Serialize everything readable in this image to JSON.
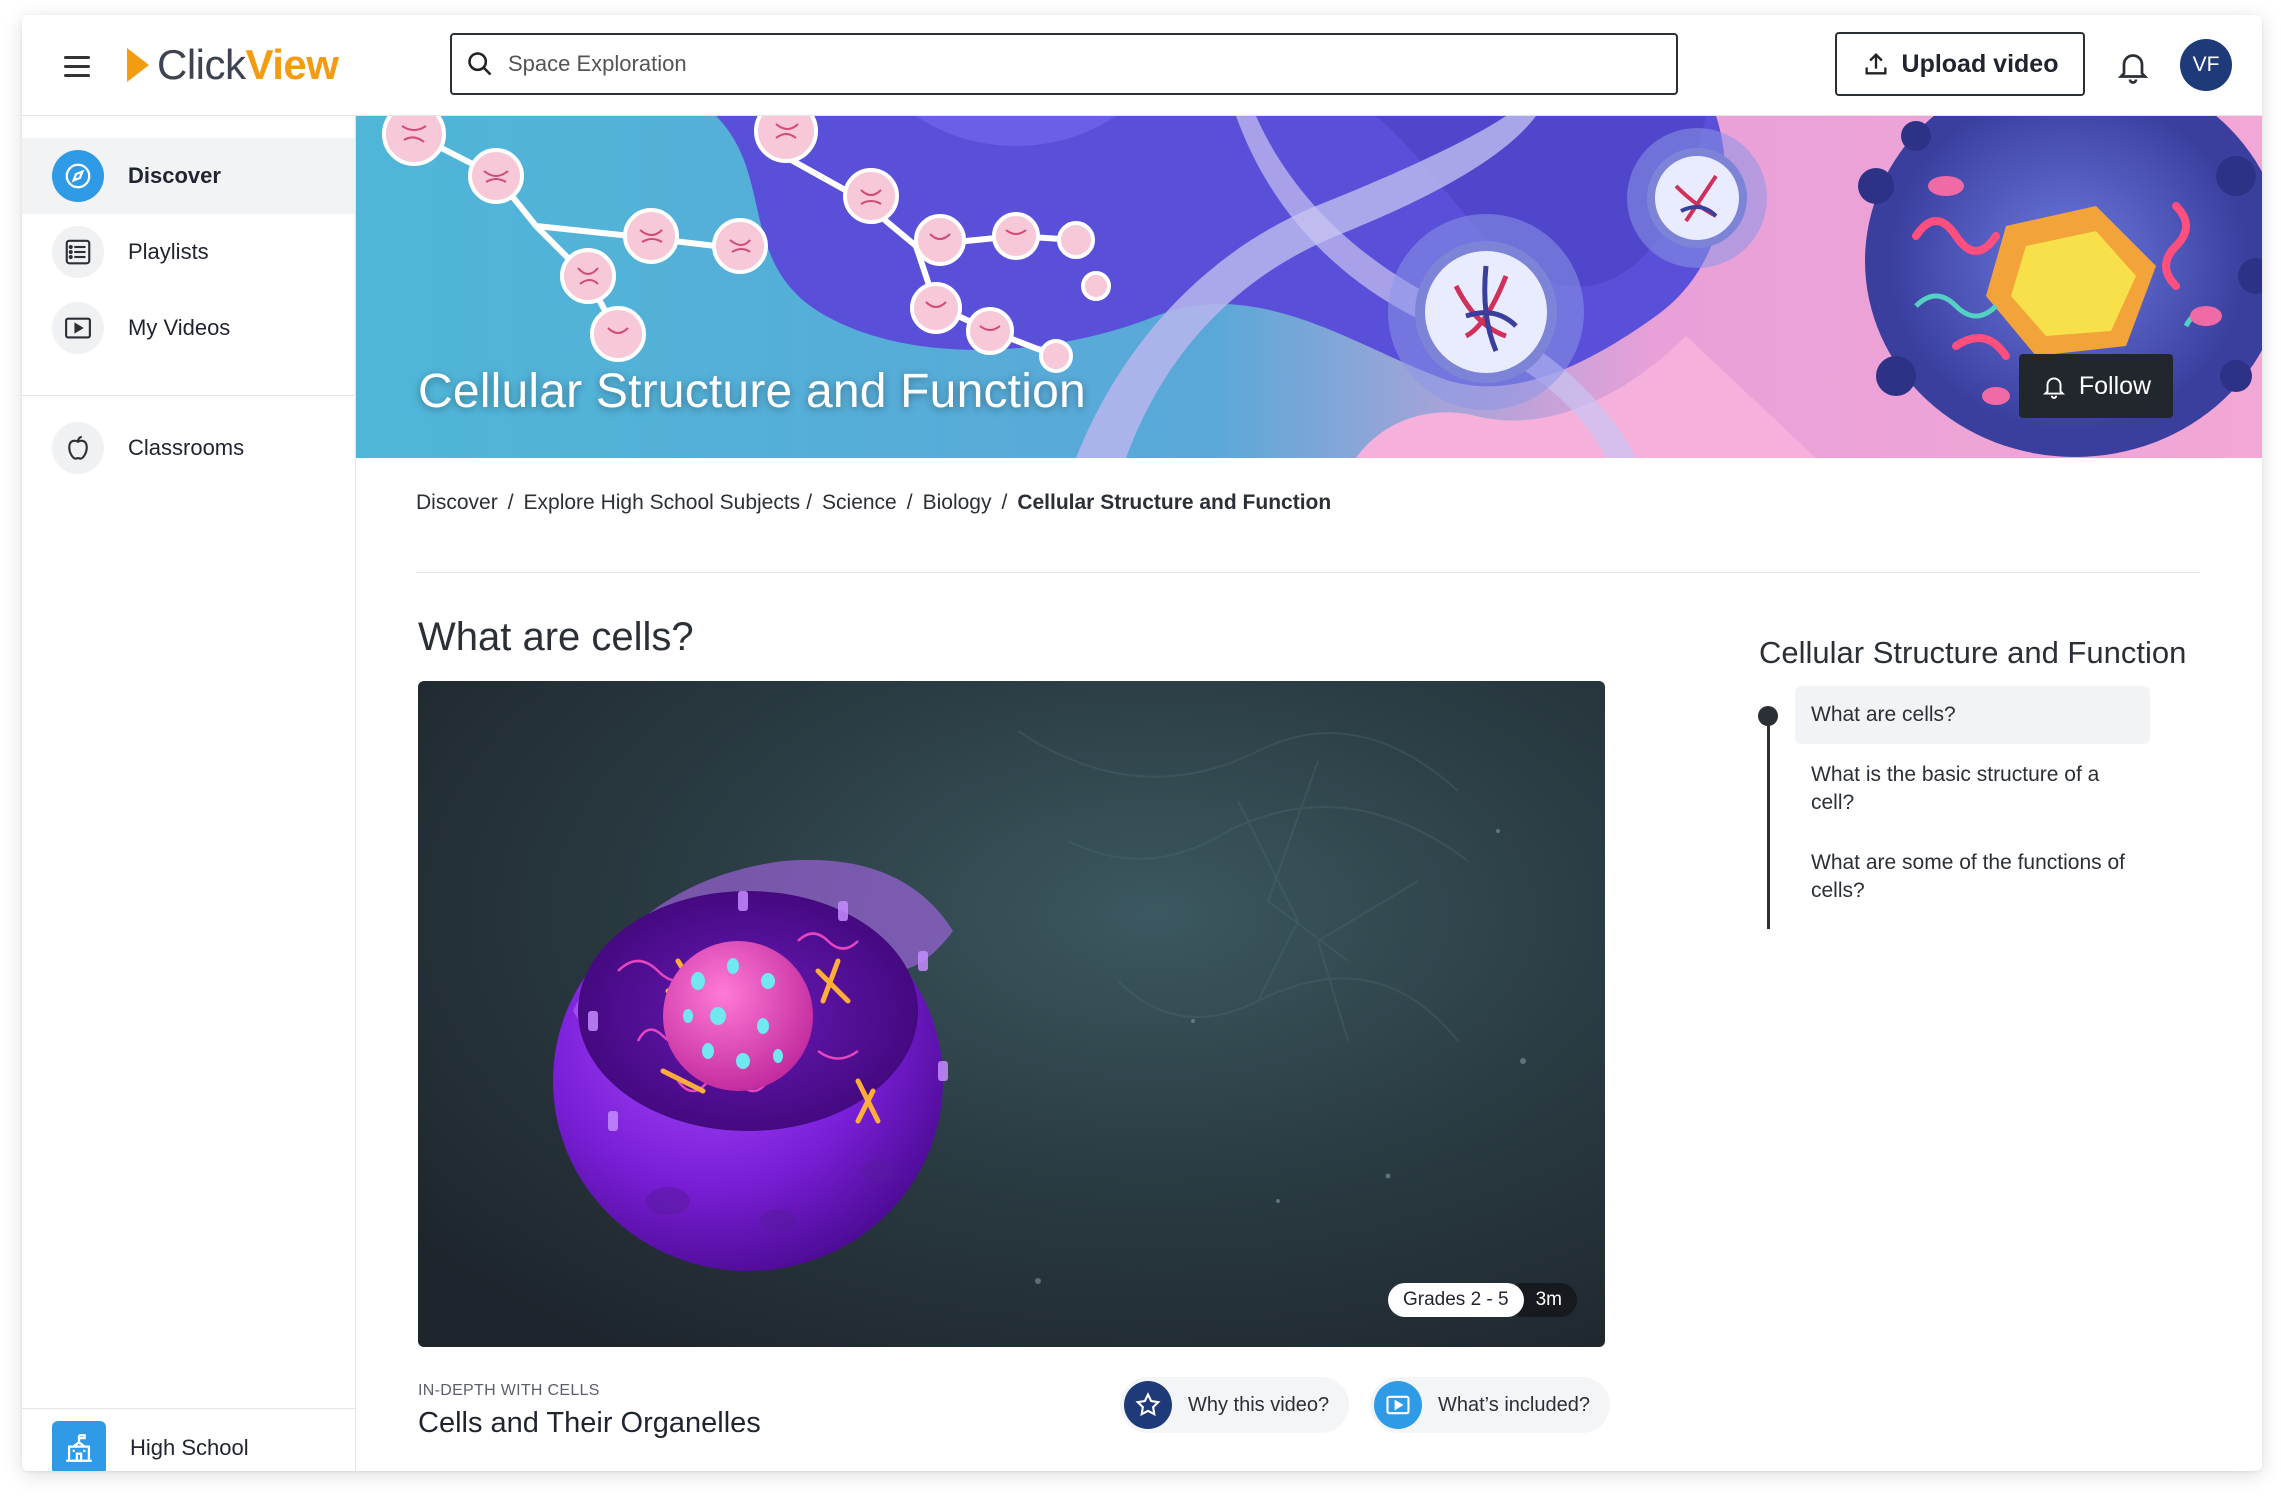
{
  "app": {
    "logo_left": "Click",
    "logo_right": "View"
  },
  "search": {
    "placeholder": "Space Exploration"
  },
  "header": {
    "upload_label": "Upload video",
    "avatar_initials": "VF"
  },
  "sidebar": {
    "items": [
      {
        "label": "Discover",
        "icon": "compass-icon",
        "active": true
      },
      {
        "label": "Playlists",
        "icon": "list-icon"
      },
      {
        "label": "My Videos",
        "icon": "play-icon"
      },
      {
        "label": "Classrooms",
        "icon": "apple-icon"
      }
    ],
    "school": {
      "label": "High School",
      "icon": "school-icon"
    }
  },
  "banner": {
    "title": "Cellular Structure and Function",
    "follow_label": "Follow"
  },
  "breadcrumb": [
    "Discover",
    "Explore High School Subjects",
    "Science",
    "Biology",
    "Cellular Structure and Function"
  ],
  "main": {
    "heading": "What are cells?",
    "video": {
      "grade_badge": "Grades 2 - 5",
      "duration": "3m",
      "series": "IN-DEPTH WITH CELLS",
      "title": "Cells and Their Organelles"
    },
    "actions": {
      "why_label": "Why this video?",
      "included_label": "What’s included?"
    }
  },
  "toc": {
    "title": "Cellular Structure and Function",
    "items": [
      "What are cells?",
      "What is the basic structure of a cell?",
      "What are some of the functions of cells?"
    ]
  },
  "colors": {
    "accent": "#2f9be6",
    "brand_orange": "#f39c12",
    "avatar_bg": "#1e3a78",
    "star_bg": "#1e3a78"
  }
}
